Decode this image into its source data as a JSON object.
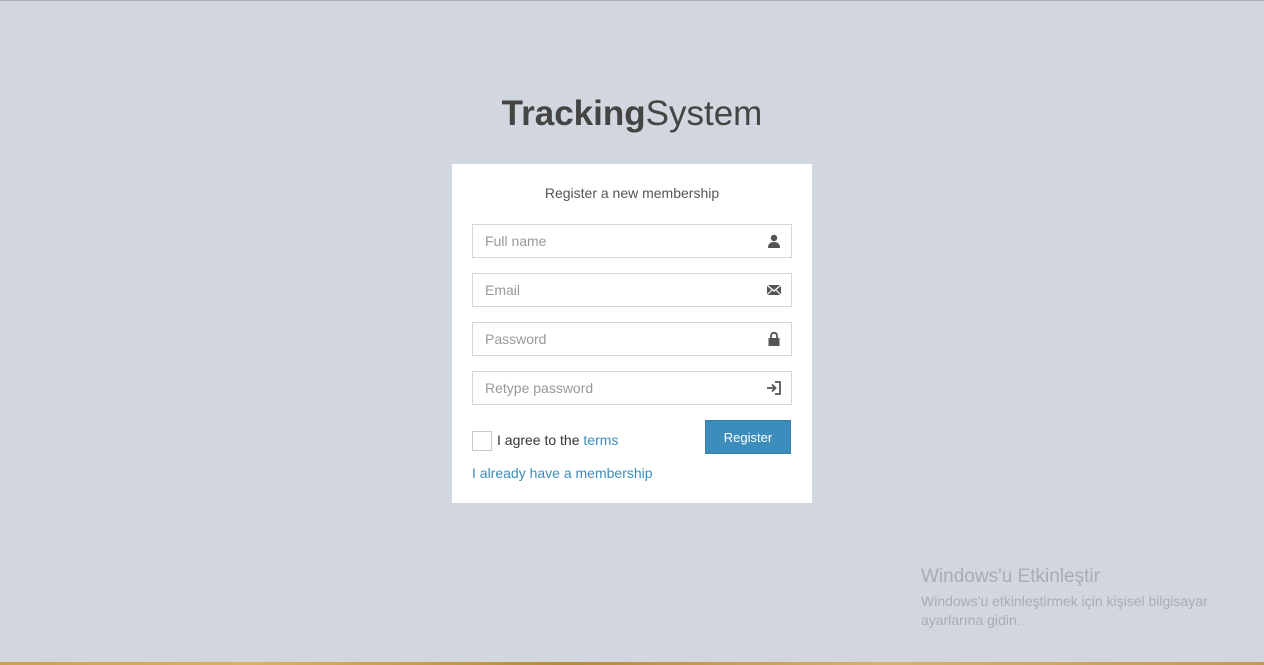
{
  "logo": {
    "bold": "Tracking",
    "light": "System"
  },
  "form": {
    "message": "Register a new membership",
    "fields": [
      {
        "placeholder": "Full name",
        "icon": "user-icon"
      },
      {
        "placeholder": "Email",
        "icon": "envelope-icon"
      },
      {
        "placeholder": "Password",
        "icon": "lock-icon"
      },
      {
        "placeholder": "Retype password",
        "icon": "log-in-icon"
      }
    ],
    "agree_text": "I agree to the",
    "terms_link": "terms",
    "register_label": "Register",
    "member_link": "I already have a membership"
  },
  "watermark": {
    "title": "Windows'u Etkinleştir",
    "body": "Windows'u etkinleştirmek için kişisel bilgisayar ayarlarına gidin."
  },
  "colors": {
    "background": "#d2d6de",
    "accent": "#3c8dbc",
    "box": "#ffffff"
  }
}
